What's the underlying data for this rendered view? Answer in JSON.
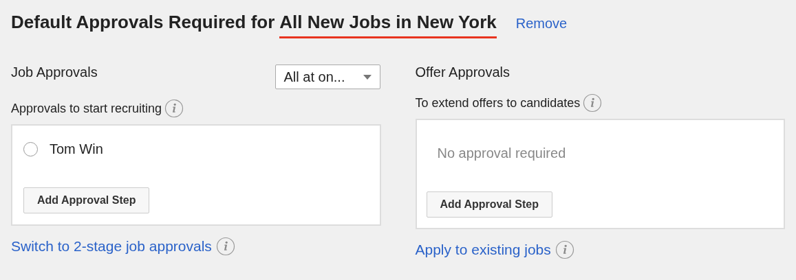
{
  "title": {
    "prefix": "Default Approvals Required for",
    "scope": "All New Jobs in New York"
  },
  "remove_link": "Remove",
  "job_approvals": {
    "heading": "Job Approvals",
    "dropdown": "All at on...",
    "subtitle": "Approvals to start recruiting",
    "approvers": [
      {
        "name": "Tom Win",
        "selected": false
      }
    ],
    "button": "Add Approval Step",
    "link": "Switch to 2-stage job approvals"
  },
  "offer_approvals": {
    "heading": "Offer Approvals",
    "subtitle": "To extend offers to candidates",
    "empty_text": "No approval required",
    "button": "Add Approval Step",
    "link": "Apply to existing jobs"
  }
}
